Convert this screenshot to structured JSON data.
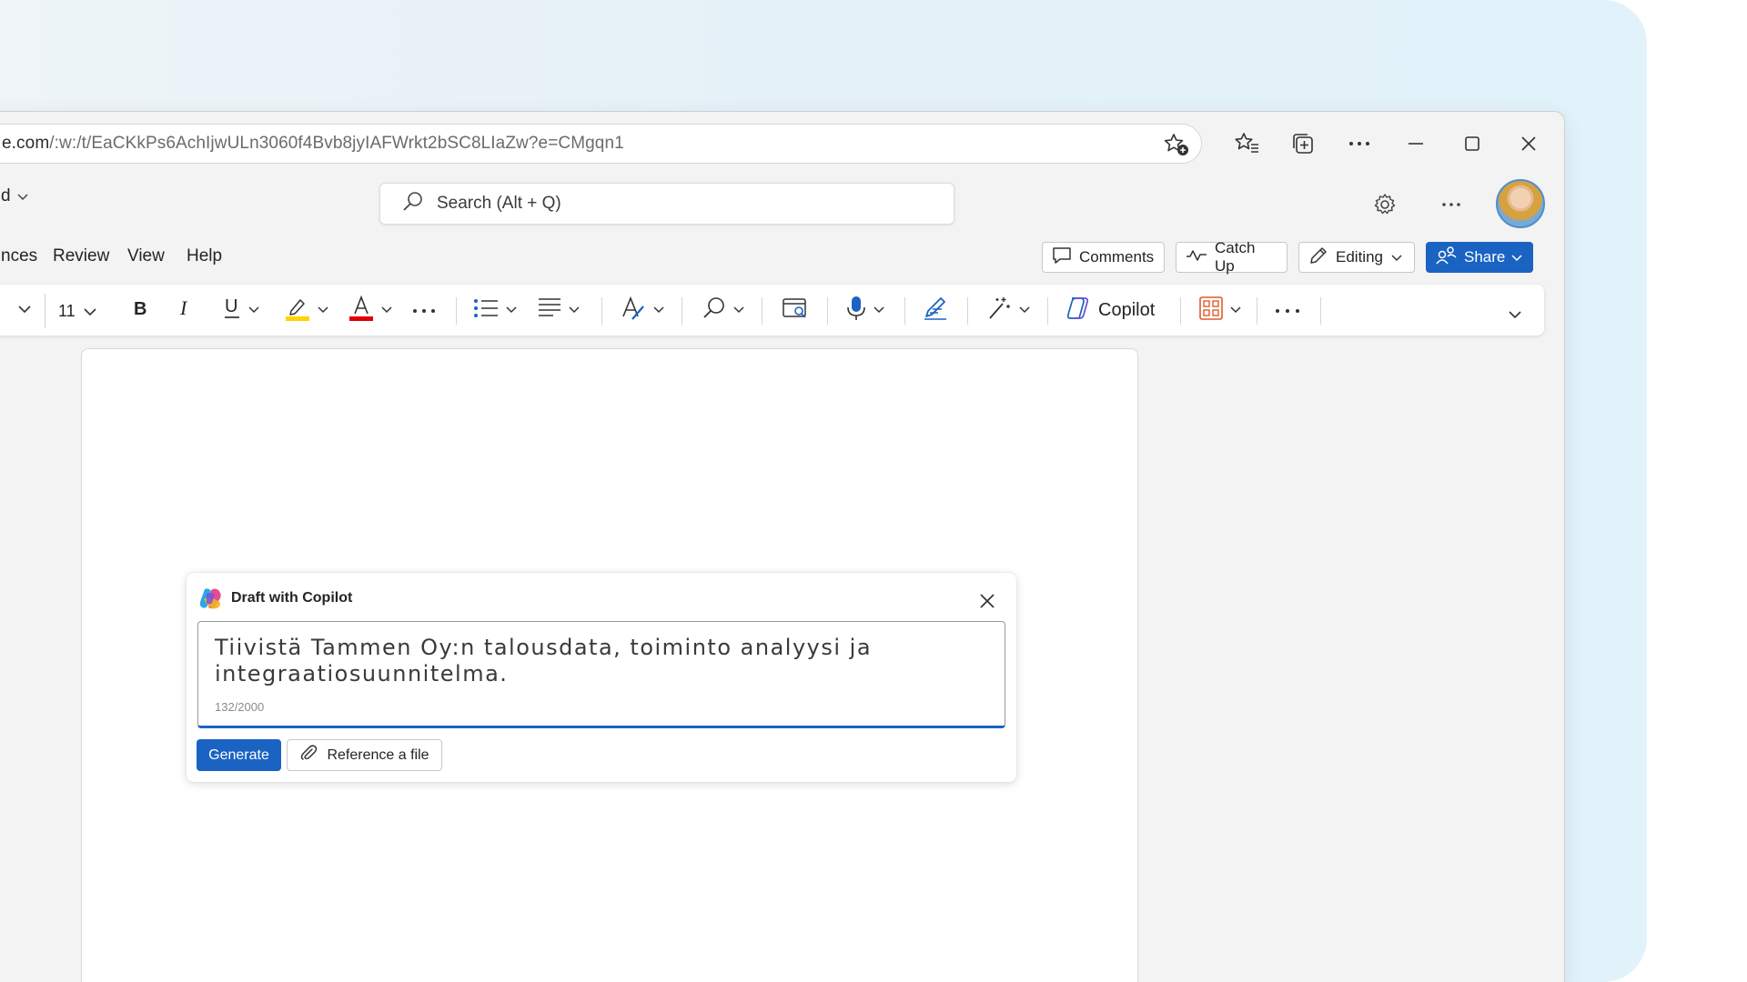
{
  "browser": {
    "address_main": "e.com",
    "address_path": "/:w:/t/EaCKkPs6AchIjwULn3060f4Bvb8jyIAFWrkt2bSC8LIaZw?e=CMgqn1",
    "icons": [
      "favorite-add-icon",
      "favorites-icon",
      "collections-icon",
      "more-icon",
      "minimize-icon",
      "maximize-icon",
      "close-icon"
    ]
  },
  "app": {
    "doc_name": "d",
    "search_placeholder": "Search (Alt + Q)"
  },
  "menu": {
    "tabs": [
      "nces",
      "Review",
      "View",
      "Help"
    ],
    "comments_label": "Comments",
    "catchup_label": "Catch Up",
    "editing_label": "Editing",
    "share_label": "Share"
  },
  "toolbar": {
    "font_size": "11",
    "copilot_label": "Copilot",
    "colors": {
      "highlight": "#ffd400",
      "font_color": "#e00000",
      "accent": "#1a63c2"
    }
  },
  "draft": {
    "title": "Draft with Copilot",
    "prompt": "Tiivistä Tammen Oy:n talousdata, toiminto analyysi ja integraatiosuunnitelma.",
    "char_count": "132/2000",
    "generate_label": "Generate",
    "reference_label": "Reference a file"
  }
}
